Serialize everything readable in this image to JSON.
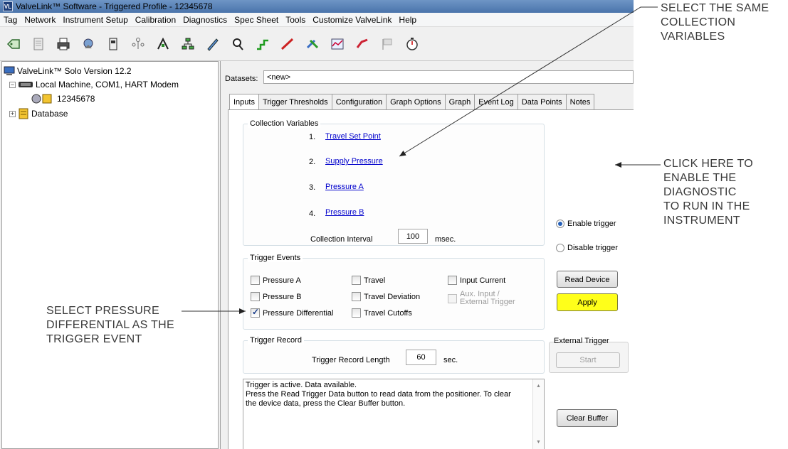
{
  "window": {
    "title": "ValveLink™ Software - Triggered Profile - 12345678",
    "app_icon_text": "VL"
  },
  "menu": [
    "Tag",
    "Network",
    "Instrument Setup",
    "Calibration",
    "Diagnostics",
    "Spec Sheet",
    "Tools",
    "Customize ValveLink",
    "Help"
  ],
  "toolbar": {
    "icons": [
      "tag-icon",
      "document-icon",
      "print-icon",
      "satellite-icon",
      "device-icon",
      "network-icon",
      "calibration-icon",
      "tree-icon",
      "pencil-icon",
      "search-icon",
      "step-icon",
      "ramp-icon",
      "tools-icon",
      "chart-icon",
      "valve-signature-icon",
      "flag-icon",
      "stopwatch-icon"
    ]
  },
  "tree": {
    "root": "ValveLink™ Solo Version 12.2",
    "machine": "Local Machine, COM1, HART Modem",
    "device": "12345678",
    "database": "Database"
  },
  "datasets": {
    "label": "Datasets:",
    "value": "<new>"
  },
  "tabs": [
    "Inputs",
    "Trigger Thresholds",
    "Configuration",
    "Graph Options",
    "Graph",
    "Event Log",
    "Data Points",
    "Notes"
  ],
  "collection": {
    "title": "Collection Variables",
    "variables": [
      {
        "num": "1.",
        "label": "Travel Set Point"
      },
      {
        "num": "2.",
        "label": "Supply Pressure"
      },
      {
        "num": "3.",
        "label": "Pressure A"
      },
      {
        "num": "4.",
        "label": "Pressure B"
      }
    ],
    "interval_label": "Collection Interval",
    "interval_value": "100",
    "interval_unit": "msec."
  },
  "trigger_mode": {
    "enable": "Enable trigger",
    "disable": "Disable trigger",
    "selected": "enable"
  },
  "trigger_events": {
    "title": "Trigger Events",
    "items": [
      {
        "label": "Pressure A",
        "checked": false
      },
      {
        "label": "Travel",
        "checked": false
      },
      {
        "label": "Input Current",
        "checked": false
      },
      {
        "label": "Pressure B",
        "checked": false
      },
      {
        "label": "Travel Deviation",
        "checked": false
      },
      {
        "label": "Pressure Differential",
        "checked": true
      },
      {
        "label": "Travel Cutoffs",
        "checked": false
      }
    ],
    "aux_line1": "Aux. Input /",
    "aux_line2": "External Trigger"
  },
  "buttons": {
    "read_device": "Read Device",
    "apply": "Apply",
    "external_trigger_label": "External Trigger",
    "start": "Start",
    "clear_buffer": "Clear Buffer"
  },
  "trigger_record": {
    "title": "Trigger Record",
    "length_label": "Trigger Record Length",
    "length_value": "60",
    "length_unit": "sec."
  },
  "status": {
    "line1": "Trigger is active.  Data available.",
    "line2": "Press the Read Trigger Data button to read data from the positioner.  To clear",
    "line3": "the device data, press the Clear Buffer button."
  },
  "callouts": {
    "collection": [
      "SELECT THE SAME",
      "COLLECTION",
      "VARIABLES"
    ],
    "enable": [
      "CLICK HERE TO",
      "ENABLE THE",
      "DIAGNOSTIC",
      "TO RUN IN THE",
      "INSTRUMENT"
    ],
    "pressure": [
      "SELECT PRESSURE",
      "DIFFERENTIAL AS THE",
      "TRIGGER EVENT"
    ]
  },
  "colors": {
    "titlebar": "#4a74ab",
    "link": "#0000cc",
    "apply_button": "#ffff1a",
    "radio_selected": "#2560b8"
  }
}
